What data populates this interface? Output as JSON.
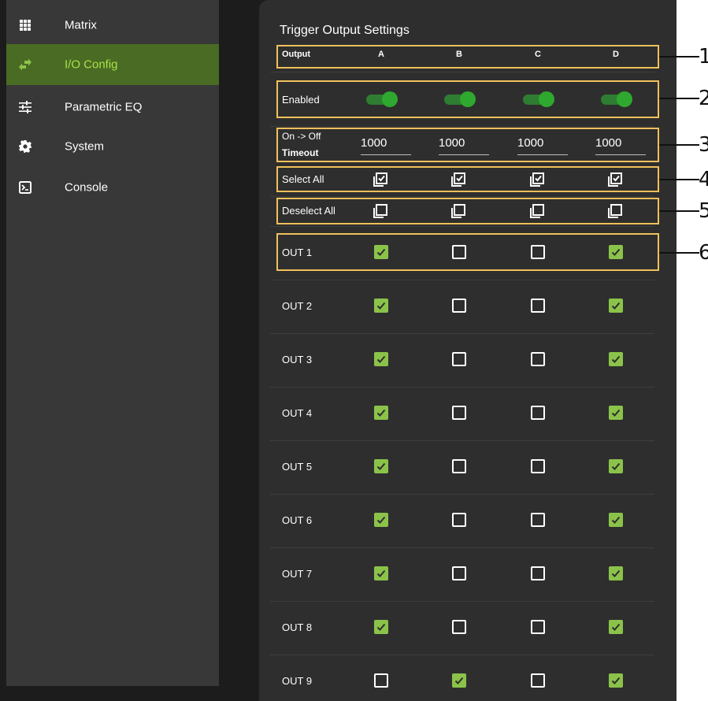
{
  "sidebar": {
    "items": [
      {
        "label": "Matrix",
        "icon": "grid-icon",
        "active": false
      },
      {
        "label": "I/O Config",
        "icon": "swap-arrows-icon",
        "active": true
      },
      {
        "label": "Parametric EQ",
        "icon": "sliders-icon",
        "active": false
      },
      {
        "label": "System",
        "icon": "gear-icon",
        "active": false
      },
      {
        "label": "Console",
        "icon": "terminal-icon",
        "active": false
      }
    ]
  },
  "panel": {
    "title": "Trigger Output Settings",
    "header": {
      "label": "Output",
      "columns": [
        "A",
        "B",
        "C",
        "D"
      ]
    },
    "enabled": {
      "label": "Enabled",
      "values": [
        true,
        true,
        true,
        true
      ]
    },
    "timeout": {
      "label_line1": "On -> Off",
      "label_line2": "Timeout",
      "values": [
        "1000",
        "1000",
        "1000",
        "1000"
      ]
    },
    "select_all": {
      "label": "Select All"
    },
    "deselect_all": {
      "label": "Deselect All"
    },
    "outputs": [
      {
        "label": "OUT 1",
        "values": [
          true,
          false,
          false,
          true
        ]
      },
      {
        "label": "OUT 2",
        "values": [
          true,
          false,
          false,
          true
        ]
      },
      {
        "label": "OUT 3",
        "values": [
          true,
          false,
          false,
          true
        ]
      },
      {
        "label": "OUT 4",
        "values": [
          true,
          false,
          false,
          true
        ]
      },
      {
        "label": "OUT 5",
        "values": [
          true,
          false,
          false,
          true
        ]
      },
      {
        "label": "OUT 6",
        "values": [
          true,
          false,
          false,
          true
        ]
      },
      {
        "label": "OUT 7",
        "values": [
          true,
          false,
          false,
          true
        ]
      },
      {
        "label": "OUT 8",
        "values": [
          true,
          false,
          false,
          true
        ]
      },
      {
        "label": "OUT 9",
        "values": [
          false,
          true,
          false,
          true
        ]
      }
    ]
  },
  "callouts": [
    "1",
    "2",
    "3",
    "4",
    "5",
    "6"
  ],
  "colors": {
    "accent": "#8bc34a",
    "active_nav": "#4a6b23",
    "toggle": "#2fa82f",
    "callout": "#f0c05a"
  }
}
